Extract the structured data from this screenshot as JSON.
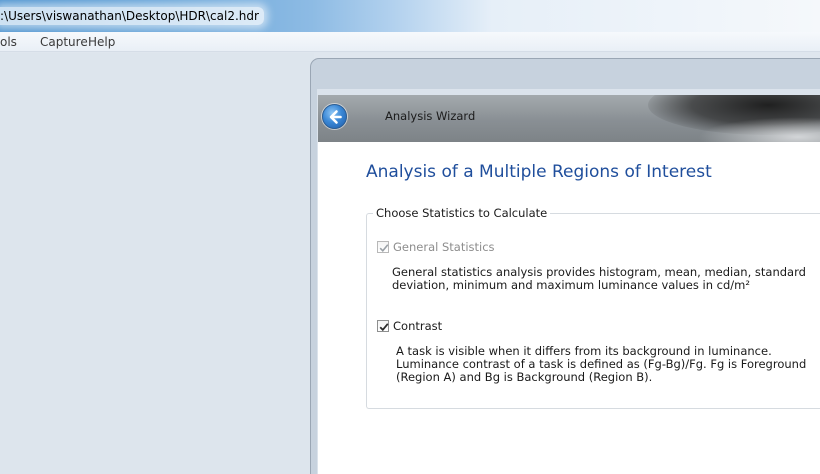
{
  "window": {
    "title": ":\\Users\\viswanathan\\Desktop\\HDR\\cal2.hdr"
  },
  "menubar": {
    "items": [
      "ols",
      "Capture",
      "Help"
    ]
  },
  "wizard": {
    "header_title": "Analysis Wizard",
    "back_icon": "back-arrow-icon",
    "page_title": "Analysis of a Multiple Regions of Interest",
    "group_label": "Choose Statistics to Calculate",
    "options": [
      {
        "label": "General Statistics",
        "checked": true,
        "enabled": false,
        "description_lines": [
          "General statistics analysis provides histogram, mean, median, standard",
          "deviation, minimum and maximum luminance values in cd/m²"
        ]
      },
      {
        "label": "Contrast",
        "checked": true,
        "enabled": true,
        "description_lines": [
          "A task is visible when it differs from its background in luminance.",
          "Luminance contrast of a task is defined as (Fg-Bg)/Fg. Fg is Foreground",
          "(Region A) and Bg is Background (Region B)."
        ]
      }
    ]
  },
  "colors": {
    "title_blue": "#1f4e9c",
    "titlebar_blue": "#4d93cf"
  }
}
